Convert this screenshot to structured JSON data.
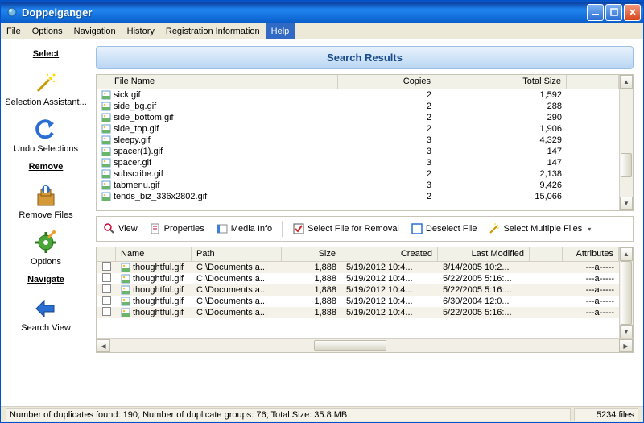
{
  "window": {
    "title": "Doppelganger"
  },
  "menubar": [
    "File",
    "Options",
    "Navigation",
    "History",
    "Registration Information",
    "Help"
  ],
  "menubar_highlighted": 5,
  "sidebar": {
    "sections": [
      {
        "heading": "Select",
        "items": [
          {
            "label": "Selection Assistant...",
            "icon": "wand-icon"
          },
          {
            "label": "Undo Selections",
            "icon": "undo-icon"
          }
        ]
      },
      {
        "heading": "Remove",
        "items": [
          {
            "label": "Remove Files",
            "icon": "remove-files-icon"
          },
          {
            "label": "Options",
            "icon": "gear-icon"
          }
        ]
      },
      {
        "heading": "Navigate",
        "items": [
          {
            "label": "Search View",
            "icon": "arrow-left-icon"
          }
        ]
      }
    ]
  },
  "panel_title": "Search Results",
  "upper_table": {
    "headers": [
      "File Name",
      "Copies",
      "Total Size"
    ],
    "rows": [
      {
        "name": "sick.gif",
        "copies": 2,
        "size": "1,592"
      },
      {
        "name": "side_bg.gif",
        "copies": 2,
        "size": "288"
      },
      {
        "name": "side_bottom.gif",
        "copies": 2,
        "size": "290"
      },
      {
        "name": "side_top.gif",
        "copies": 2,
        "size": "1,906"
      },
      {
        "name": "sleepy.gif",
        "copies": 3,
        "size": "4,329"
      },
      {
        "name": "spacer(1).gif",
        "copies": 3,
        "size": "147"
      },
      {
        "name": "spacer.gif",
        "copies": 3,
        "size": "147"
      },
      {
        "name": "subscribe.gif",
        "copies": 2,
        "size": "2,138"
      },
      {
        "name": "tabmenu.gif",
        "copies": 3,
        "size": "9,426"
      },
      {
        "name": "tends_biz_336x2802.gif",
        "copies": 2,
        "size": "15,066"
      }
    ]
  },
  "toolbar": {
    "view": "View",
    "properties": "Properties",
    "media": "Media Info",
    "select_removal": "Select File for Removal",
    "deselect": "Deselect File",
    "select_multiple": "Select Multiple Files"
  },
  "lower_table": {
    "headers": [
      "Name",
      "Path",
      "Size",
      "Created",
      "Last Modified",
      "Attributes"
    ],
    "rows": [
      {
        "name": "thoughtful.gif",
        "path": "C:\\Documents a...",
        "size": "1,888",
        "created": "5/19/2012 10:4...",
        "modified": "3/14/2005 10:2...",
        "attr": "---a-----"
      },
      {
        "name": "thoughtful.gif",
        "path": "C:\\Documents a...",
        "size": "1,888",
        "created": "5/19/2012 10:4...",
        "modified": "5/22/2005 5:16:...",
        "attr": "---a-----"
      },
      {
        "name": "thoughtful.gif",
        "path": "C:\\Documents a...",
        "size": "1,888",
        "created": "5/19/2012 10:4...",
        "modified": "5/22/2005 5:16:...",
        "attr": "---a-----"
      },
      {
        "name": "thoughtful.gif",
        "path": "C:\\Documents a...",
        "size": "1,888",
        "created": "5/19/2012 10:4...",
        "modified": "6/30/2004 12:0...",
        "attr": "---a-----"
      },
      {
        "name": "thoughtful.gif",
        "path": "C:\\Documents a...",
        "size": "1,888",
        "created": "5/19/2012 10:4...",
        "modified": "5/22/2005 5:16:...",
        "attr": "---a-----"
      }
    ]
  },
  "statusbar": {
    "left": "Number of duplicates found: 190; Number of duplicate groups: 76; Total Size: 35.8 MB",
    "right": "5234 files"
  }
}
